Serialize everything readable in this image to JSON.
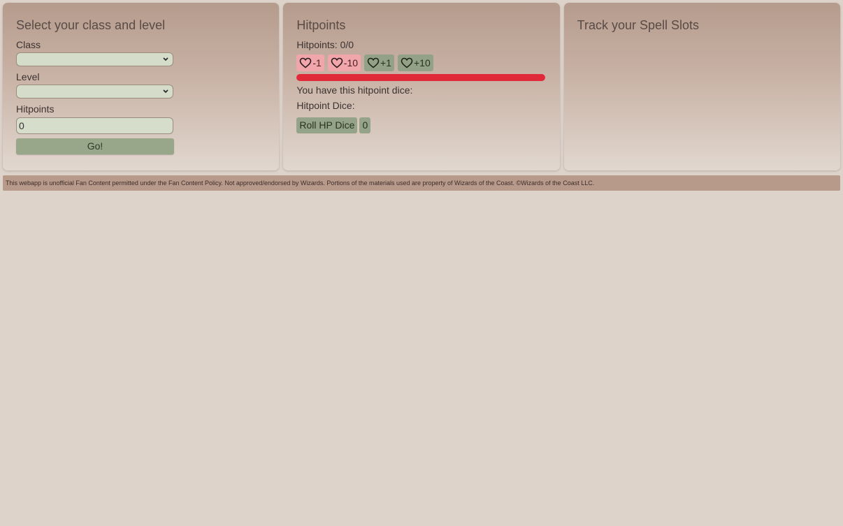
{
  "class_panel": {
    "title": "Select your class and level",
    "class_label": "Class",
    "class_value": "",
    "level_label": "Level",
    "level_value": "",
    "hitpoints_label": "Hitpoints",
    "hitpoints_value": "0",
    "go_label": "Go!"
  },
  "hp_panel": {
    "title": "Hitpoints",
    "hitpoints_text": "Hitpoints: 0/0",
    "buttons": [
      {
        "label": "-1",
        "icon": "heart-icon"
      },
      {
        "label": "-10",
        "icon": "heart-icon"
      },
      {
        "label": "+1",
        "icon": "heart-icon"
      },
      {
        "label": "+10",
        "icon": "heart-icon"
      }
    ],
    "dice_info": "You have this hitpoint dice:",
    "dice_label": "Hitpoint Dice:",
    "roll_label": "Roll HP Dice",
    "roll_result": "0",
    "bar_color": "#e02a3a"
  },
  "spell_panel": {
    "title": "Track your Spell Slots"
  },
  "footer": {
    "text": "This webapp is unofficial Fan Content permitted under the Fan Content Policy. Not approved/endorsed by Wizards. Portions of the materials used are property of Wizards of the Coast. ©Wizards of the Coast LLC."
  }
}
